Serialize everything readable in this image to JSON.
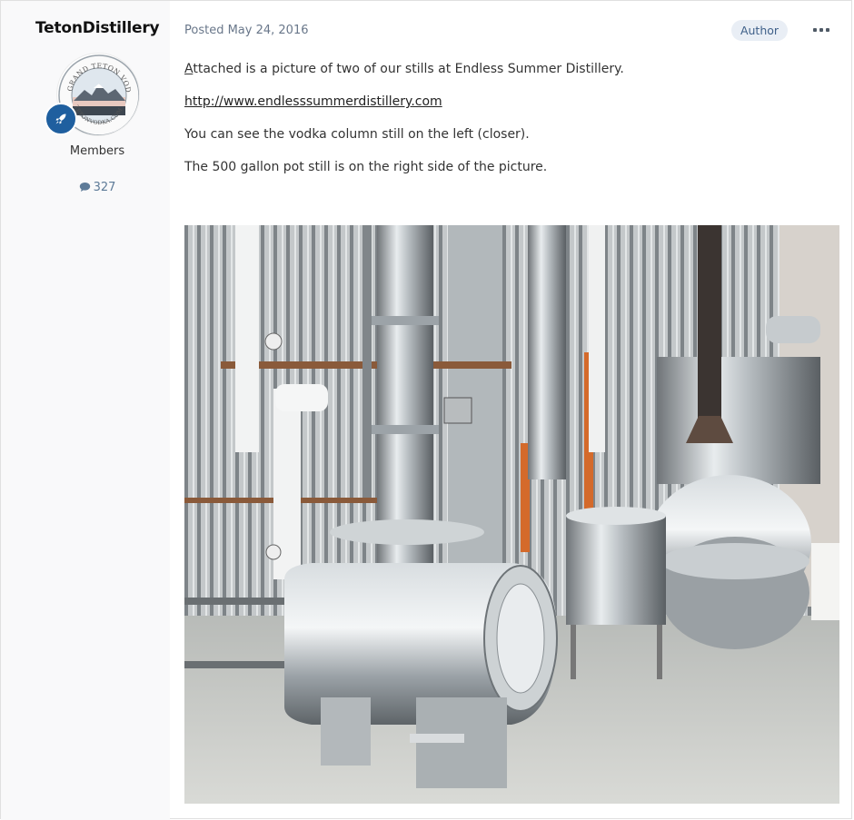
{
  "author": {
    "name": "TetonDistillery",
    "group": "Members",
    "post_count": "327",
    "avatar_text": "GRAND TETON VODKA",
    "avatar_url_text": "TETONVODKA.COM"
  },
  "post": {
    "date_label": "Posted May 24, 2016",
    "author_badge": "Author",
    "paragraphs": {
      "p1_first": "A",
      "p1_rest": "ttached is a picture of two of our stills at Endless Summer Distillery.",
      "link": "http://www.endlesssummerdistillery.com",
      "p3": "You can see the vodka column still on the left (closer).",
      "p4": "The 500 gallon pot still is on the right side of the picture."
    }
  },
  "icons": {
    "more": "more-horizontal-icon",
    "comment": "comment-icon",
    "badge": "rocket-icon"
  },
  "colors": {
    "author_badge_bg": "#e9eef5",
    "group_badge": "#1f5f9f",
    "meta_text": "#69778a"
  }
}
